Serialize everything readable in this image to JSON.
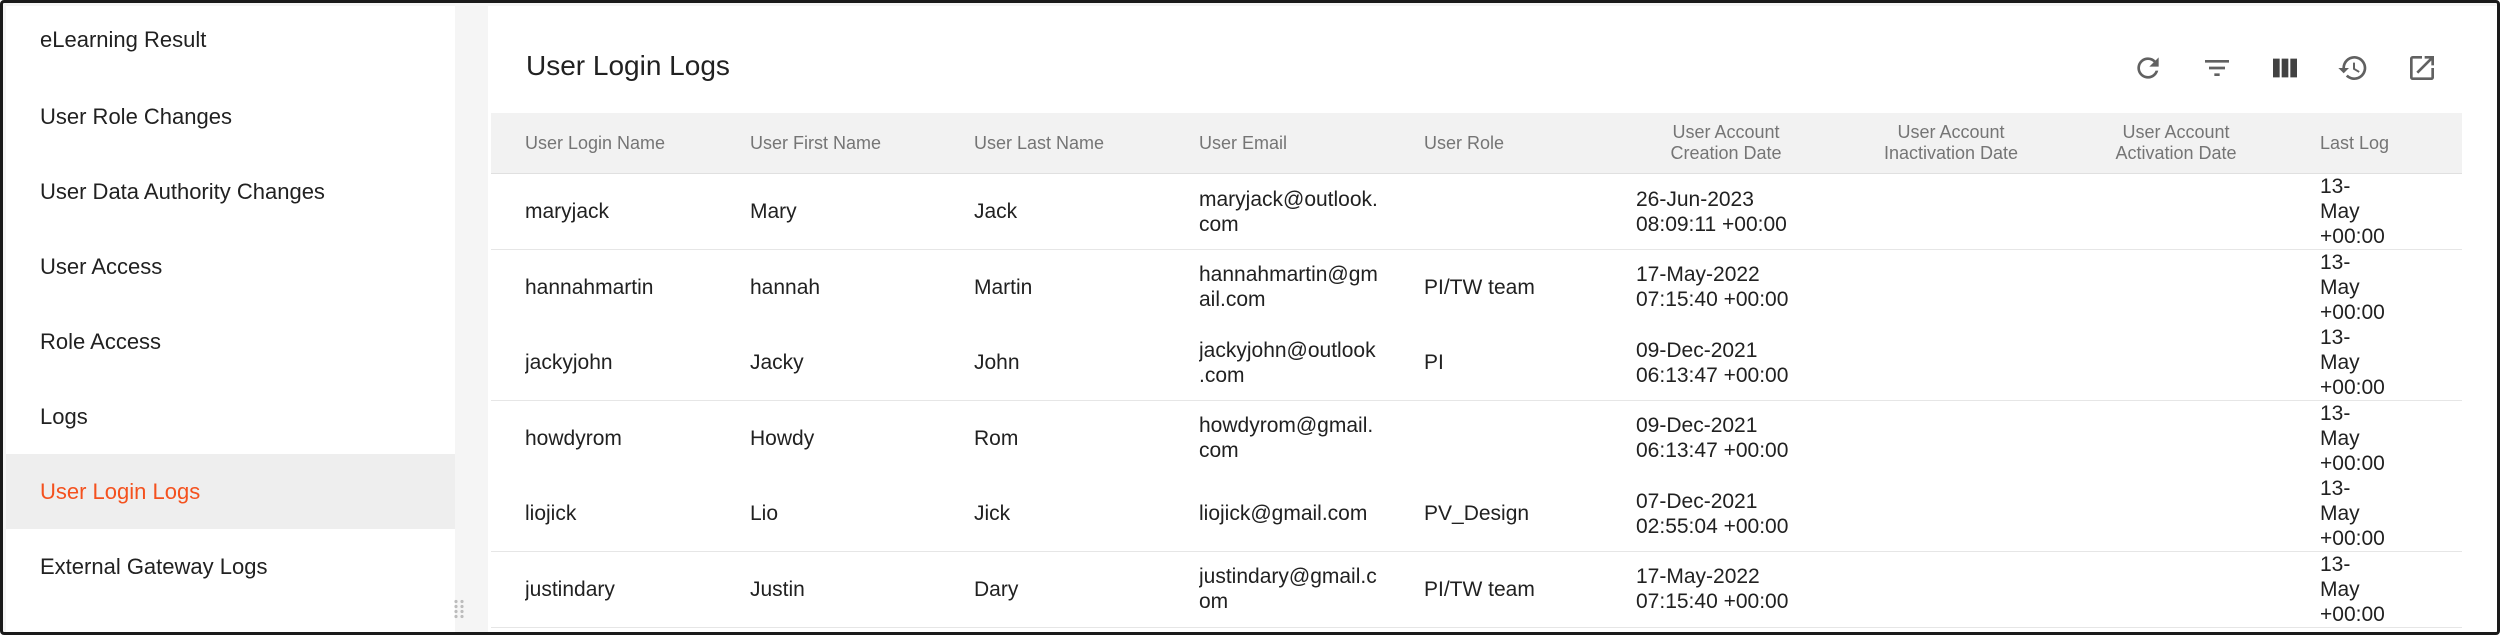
{
  "sidebar": {
    "items": [
      {
        "label": "eLearning Result"
      },
      {
        "label": "User Role Changes"
      },
      {
        "label": "User Data Authority Changes"
      },
      {
        "label": "User Access"
      },
      {
        "label": "Role Access"
      },
      {
        "label": "Logs"
      },
      {
        "label": "User Login Logs",
        "active": true
      },
      {
        "label": "External Gateway Logs"
      }
    ]
  },
  "main": {
    "title": "User Login Logs",
    "toolbar_icons": [
      "refresh-icon",
      "filter-icon",
      "columns-icon",
      "history-icon",
      "open-external-icon"
    ]
  },
  "table": {
    "columns": [
      "User Login Name",
      "User First Name",
      "User Last Name",
      "User Email",
      "User Role",
      "User Account\nCreation Date",
      "User Account\nInactivation Date",
      "User Account\nActivation Date",
      "Last Log"
    ],
    "rows": [
      [
        "maryjack",
        "Mary",
        "Jack",
        "maryjack@outlook.\ncom",
        "",
        "26-Jun-2023\n08:09:11 +00:00",
        "",
        "",
        "13-May\n+00:00"
      ],
      [
        "hannahmartin",
        "hannah",
        "Martin",
        "hannahmartin@gm\nail.com",
        "PI/TW team",
        "17-May-2022\n07:15:40 +00:00",
        "",
        "",
        "13-May\n+00:00"
      ],
      [
        "jackyjohn",
        "Jacky",
        "John",
        "jackyjohn@outlook\n.com",
        "PI",
        "09-Dec-2021\n06:13:47 +00:00",
        "",
        "",
        "13-May\n+00:00"
      ],
      [
        "howdyrom",
        "Howdy",
        "Rom",
        "howdyrom@gmail.\ncom",
        "",
        "09-Dec-2021\n06:13:47 +00:00",
        "",
        "",
        "13-May\n+00:00"
      ],
      [
        "liojick",
        "Lio",
        "Jick",
        "liojick@gmail.com",
        "PV_Design",
        "07-Dec-2021\n02:55:04 +00:00",
        "",
        "",
        "13-May\n+00:00"
      ],
      [
        "justindary",
        "Justin",
        "Dary",
        "justindary@gmail.c\nom",
        "PI/TW team",
        "17-May-2022\n07:15:40 +00:00",
        "",
        "",
        "13-May\n+00:00"
      ]
    ]
  },
  "colors": {
    "accent": "#f4511e",
    "header_bg": "#f2f2f2",
    "active_bg": "#eeeeee"
  }
}
